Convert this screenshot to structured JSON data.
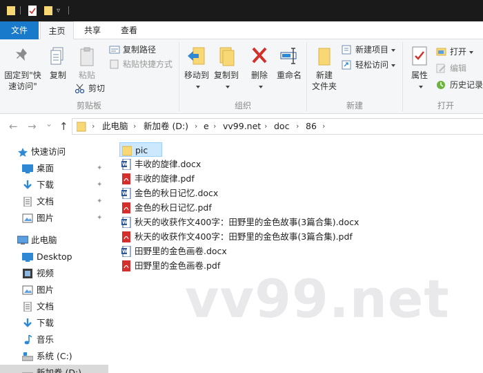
{
  "titlebar": {},
  "tabs": [
    "文件",
    "主页",
    "共享",
    "查看"
  ],
  "ribbon": {
    "clipboard": {
      "group_label": "剪贴板",
      "pin_label_1": "固定到\"快",
      "pin_label_2": "速访问\"",
      "copy": "复制",
      "paste": "粘贴",
      "copy_path": "复制路径",
      "paste_shortcut": "粘贴快捷方式",
      "cut": "剪切"
    },
    "organize": {
      "group_label": "组织",
      "move_to": "移动到",
      "copy_to": "复制到",
      "delete": "删除",
      "rename": "重命名"
    },
    "new": {
      "group_label": "新建",
      "new_folder_1": "新建",
      "new_folder_2": "文件夹",
      "new_item": "新建项目",
      "easy_access": "轻松访问"
    },
    "open": {
      "group_label": "打开",
      "properties": "属性",
      "open": "打开",
      "edit": "编辑",
      "history": "历史记录"
    }
  },
  "address": {
    "back": "←",
    "forward": "→",
    "recent": "⌄",
    "up": "↑",
    "crumbs": [
      "此电脑",
      "新加卷 (D:)",
      "e",
      "vv99.net",
      "doc",
      "86"
    ]
  },
  "navpane": {
    "quick_access": "快速访问",
    "quick_items": [
      "桌面",
      "下载",
      "文档",
      "图片"
    ],
    "this_pc": "此电脑",
    "pc_items": [
      "Desktop",
      "视频",
      "图片",
      "文档",
      "下载",
      "音乐",
      "系统 (C:)",
      "新加卷 (D:)"
    ]
  },
  "files": [
    {
      "name": "pic",
      "type": "folder"
    },
    {
      "name": "丰收的旋律.docx",
      "type": "docx"
    },
    {
      "name": "丰收的旋律.pdf",
      "type": "pdf"
    },
    {
      "name": "金色的秋日记忆.docx",
      "type": "docx"
    },
    {
      "name": "金色的秋日记忆.pdf",
      "type": "pdf"
    },
    {
      "name": "秋天的收获作文400字：田野里的金色故事(3篇合集).docx",
      "type": "docx"
    },
    {
      "name": "秋天的收获作文400字：田野里的金色故事(3篇合集).pdf",
      "type": "pdf"
    },
    {
      "name": "田野里的金色画卷.docx",
      "type": "docx"
    },
    {
      "name": "田野里的金色画卷.pdf",
      "type": "pdf"
    }
  ],
  "watermark": "vv99.net",
  "colors": {
    "accent": "#1979ca",
    "folder": "#f8d775",
    "pdf": "#d62d2d",
    "word": "#2b5797"
  }
}
